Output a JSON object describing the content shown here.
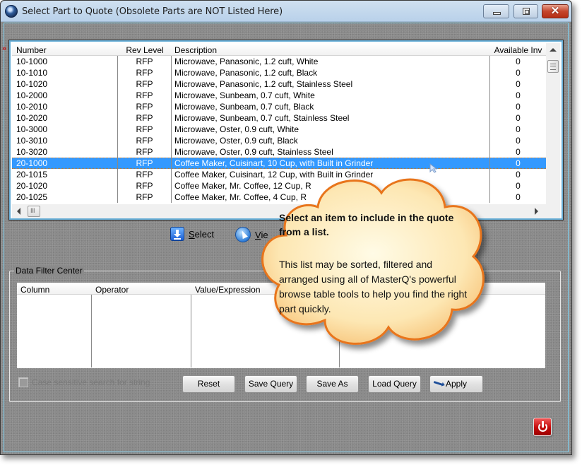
{
  "window": {
    "title": "Select Part to Quote  (Obsolete Parts are NOT Listed Here)",
    "controls": [
      "minimize",
      "maximize",
      "close"
    ]
  },
  "parts_list": {
    "row_indicator": "»",
    "columns": [
      "Number",
      "Rev Level",
      "Description",
      "Available Inv"
    ],
    "rows": [
      {
        "number": "10-1000",
        "rev": "RFP",
        "description": "Microwave, Panasonic, 1.2 cuft, White",
        "inv": "0"
      },
      {
        "number": "10-1010",
        "rev": "RFP",
        "description": "Microwave, Panasonic, 1.2 cuft, Black",
        "inv": "0"
      },
      {
        "number": "10-1020",
        "rev": "RFP",
        "description": "Microwave, Panasonic, 1.2 cuft, Stainless Steel",
        "inv": "0"
      },
      {
        "number": "10-2000",
        "rev": "RFP",
        "description": "Microwave, Sunbeam, 0.7 cuft, White",
        "inv": "0"
      },
      {
        "number": "10-2010",
        "rev": "RFP",
        "description": "Microwave, Sunbeam, 0.7 cuft, Black",
        "inv": "0"
      },
      {
        "number": "10-2020",
        "rev": "RFP",
        "description": "Microwave, Sunbeam, 0.7 cuft, Stainless Steel",
        "inv": "0"
      },
      {
        "number": "10-3000",
        "rev": "RFP",
        "description": "Microwave, Oster, 0.9 cuft, White",
        "inv": "0"
      },
      {
        "number": "10-3010",
        "rev": "RFP",
        "description": "Microwave, Oster, 0.9 cuft, Black",
        "inv": "0"
      },
      {
        "number": "10-3020",
        "rev": "RFP",
        "description": "Microwave, Oster, 0.9 cuft, Stainless Steel",
        "inv": "0"
      },
      {
        "number": "20-1000",
        "rev": "RFP",
        "description": "Coffee Maker, Cuisinart, 10 Cup, with Built in Grinder",
        "inv": "0",
        "selected": true
      },
      {
        "number": "20-1015",
        "rev": "RFP",
        "description": "Coffee Maker, Cuisinart, 12 Cup, with Built in Grinder",
        "inv": "0"
      },
      {
        "number": "20-1020",
        "rev": "RFP",
        "description": "Coffee Maker, Mr. Coffee, 12 Cup, R",
        "inv": "0"
      },
      {
        "number": "20-1025",
        "rev": "RFP",
        "description": "Coffee Maker, Mr. Coffee, 4 Cup, R",
        "inv": "0"
      }
    ],
    "selected_color": "#3399ff"
  },
  "actions": {
    "select": {
      "label_underlined": "S",
      "label_rest": "elect",
      "icon": "download-arrow-icon"
    },
    "view": {
      "label_underlined": "V",
      "label_rest": "ie",
      "icon": "cursor-arrow-icon"
    }
  },
  "filter_center": {
    "legend": "Data Filter Center",
    "columns": [
      "Column",
      "Operator",
      "Value/Expression",
      ""
    ],
    "case_sensitive_label": "Case sensitive search for string",
    "case_sensitive_checked": false,
    "buttons": {
      "reset": "Reset",
      "save_query": "Save Query",
      "save_as": "Save As",
      "load_query": "Load Query",
      "apply": "Apply"
    }
  },
  "callout": {
    "title": "Select an item to include in the quote from a list.",
    "body": "This list may be sorted, filtered and arranged using all of MasterQ's powerful browse table tools to help you find the right part quickly.",
    "fill_color": "#fde3a8",
    "border_color": "#e87a1c"
  },
  "colors": {
    "window_bg": "#8a8a8a",
    "power_button": "#c20b0b",
    "frame_accent": "#6ab0d8"
  }
}
